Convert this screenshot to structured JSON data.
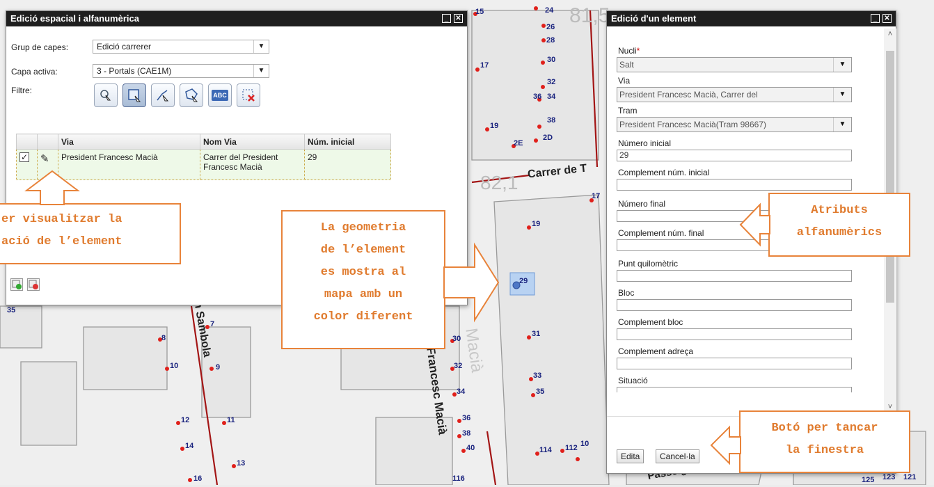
{
  "map": {
    "grid_values": [
      "81,5",
      "82,1"
    ],
    "streets": [
      "Carrer de T",
      "Francesc Macià",
      "n Sambola",
      "Passeig d"
    ],
    "faded_labels": [
      "Macià"
    ],
    "highlighted_number": "29",
    "numbers": [
      "15",
      "24",
      "26",
      "28",
      "30",
      "32",
      "36",
      "34",
      "38",
      "2D",
      "2E",
      "17",
      "19",
      "17",
      "19",
      "31",
      "33",
      "35",
      "30",
      "32",
      "34",
      "36",
      "38",
      "40",
      "114",
      "112",
      "10",
      "116",
      "125",
      "123",
      "121",
      "7",
      "8",
      "9",
      "10",
      "11",
      "12",
      "13",
      "14",
      "16",
      "35"
    ]
  },
  "left_window": {
    "title": "Edició espacial i alfanumèrica",
    "group_label": "Grup de capes:",
    "group_value": "Edició carrerer",
    "layer_label": "Capa activa:",
    "layer_value": "3 - Portals (CAE1M)",
    "filter_label": "Filtre:",
    "tools": [
      "pointer-icon",
      "select-rectangle-icon",
      "select-line-icon",
      "select-polygon-icon",
      "text-abc-icon",
      "clear-selection-icon"
    ],
    "tool_abc_text": "ABC",
    "table": {
      "headers": [
        "Via",
        "Nom Via",
        "Núm. inicial"
      ],
      "row": {
        "via": "President Francesc Macià",
        "nom_via": "Carrer del President Francesc Macià",
        "num_inicial": "29"
      }
    }
  },
  "right_window": {
    "title": "Edició d'un element",
    "fields": {
      "nucli_label": "Nucli",
      "nucli_required": "*",
      "nucli_value": "Salt",
      "via_label": "Via",
      "via_value": "President Francesc Macià, Carrer del",
      "tram_label": "Tram",
      "tram_value": "President Francesc Macià(Tram 98667)",
      "numero_inicial_label": "Número inicial",
      "numero_inicial_value": "29",
      "complement_num_inicial_label": "Complement núm. inicial",
      "numero_final_label": "Número final",
      "complement_num_final_label": "Complement núm. final",
      "punt_quilometric_label": "Punt quilomètric",
      "bloc_label": "Bloc",
      "complement_bloc_label": "Complement bloc",
      "complement_adreca_label": "Complement adreça",
      "situacio_label": "Situació"
    },
    "buttons": {
      "edit": "Edita",
      "cancel": "Cancel·la"
    }
  },
  "callouts": {
    "view_element": [
      "er visualitzar la",
      "ació de l’element"
    ],
    "geometry": [
      "La geometria",
      "de l’element",
      "es mostra al",
      "mapa amb un",
      "color diferent"
    ],
    "attributes": [
      "Atributs",
      "alfanumèrics"
    ],
    "close_button": [
      "Botó per tancar",
      "la finestra"
    ]
  },
  "colors": {
    "accent": "#e8833a",
    "title_bar": "#1f1f1f",
    "map_street": "#a31515",
    "map_point": "#e0201b",
    "map_number": "#1a237e"
  }
}
